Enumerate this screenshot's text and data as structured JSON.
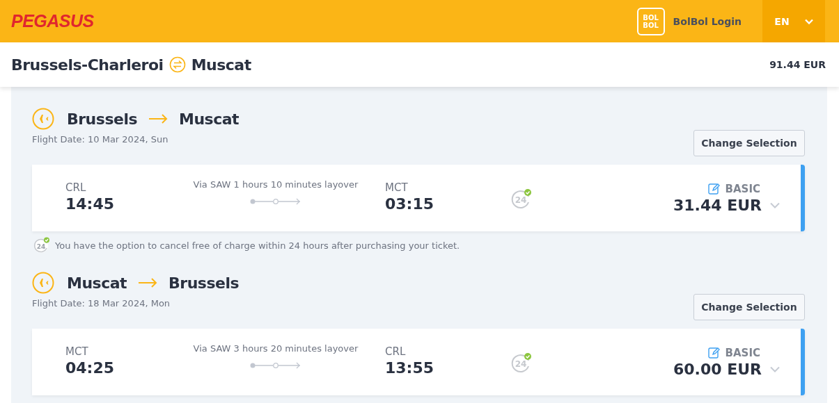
{
  "header": {
    "logo": "PEGASUS",
    "bolbol_logo": [
      "BOL",
      "BOL"
    ],
    "login": "BolBol Login",
    "language": "EN"
  },
  "summary": {
    "origin": "Brussels-Charleroi",
    "destination": "Muscat",
    "total": "91.44 EUR"
  },
  "flights": [
    {
      "from": "Brussels",
      "to": "Muscat",
      "date": "Flight Date: 10 Mar 2024, Sun",
      "button": "Change Selection",
      "dep_code": "CRL",
      "dep_time": "14:45",
      "via": "Via SAW 1 hours 10 minutes layover",
      "arr_code": "MCT",
      "arr_time": "03:15",
      "badge": "24",
      "fare": "BASIC",
      "price": "31.44 EUR",
      "note_badge": "24",
      "note": "You have the option to cancel free of charge within 24 hours after purchasing your ticket."
    },
    {
      "from": "Muscat",
      "to": "Brussels",
      "date": "Flight Date: 18 Mar 2024, Mon",
      "button": "Change Selection",
      "dep_code": "MCT",
      "dep_time": "04:25",
      "via": "Via SAW 3 hours 20 minutes layover",
      "arr_code": "CRL",
      "arr_time": "13:55",
      "badge": "24",
      "fare": "BASIC",
      "price": "60.00 EUR"
    }
  ]
}
